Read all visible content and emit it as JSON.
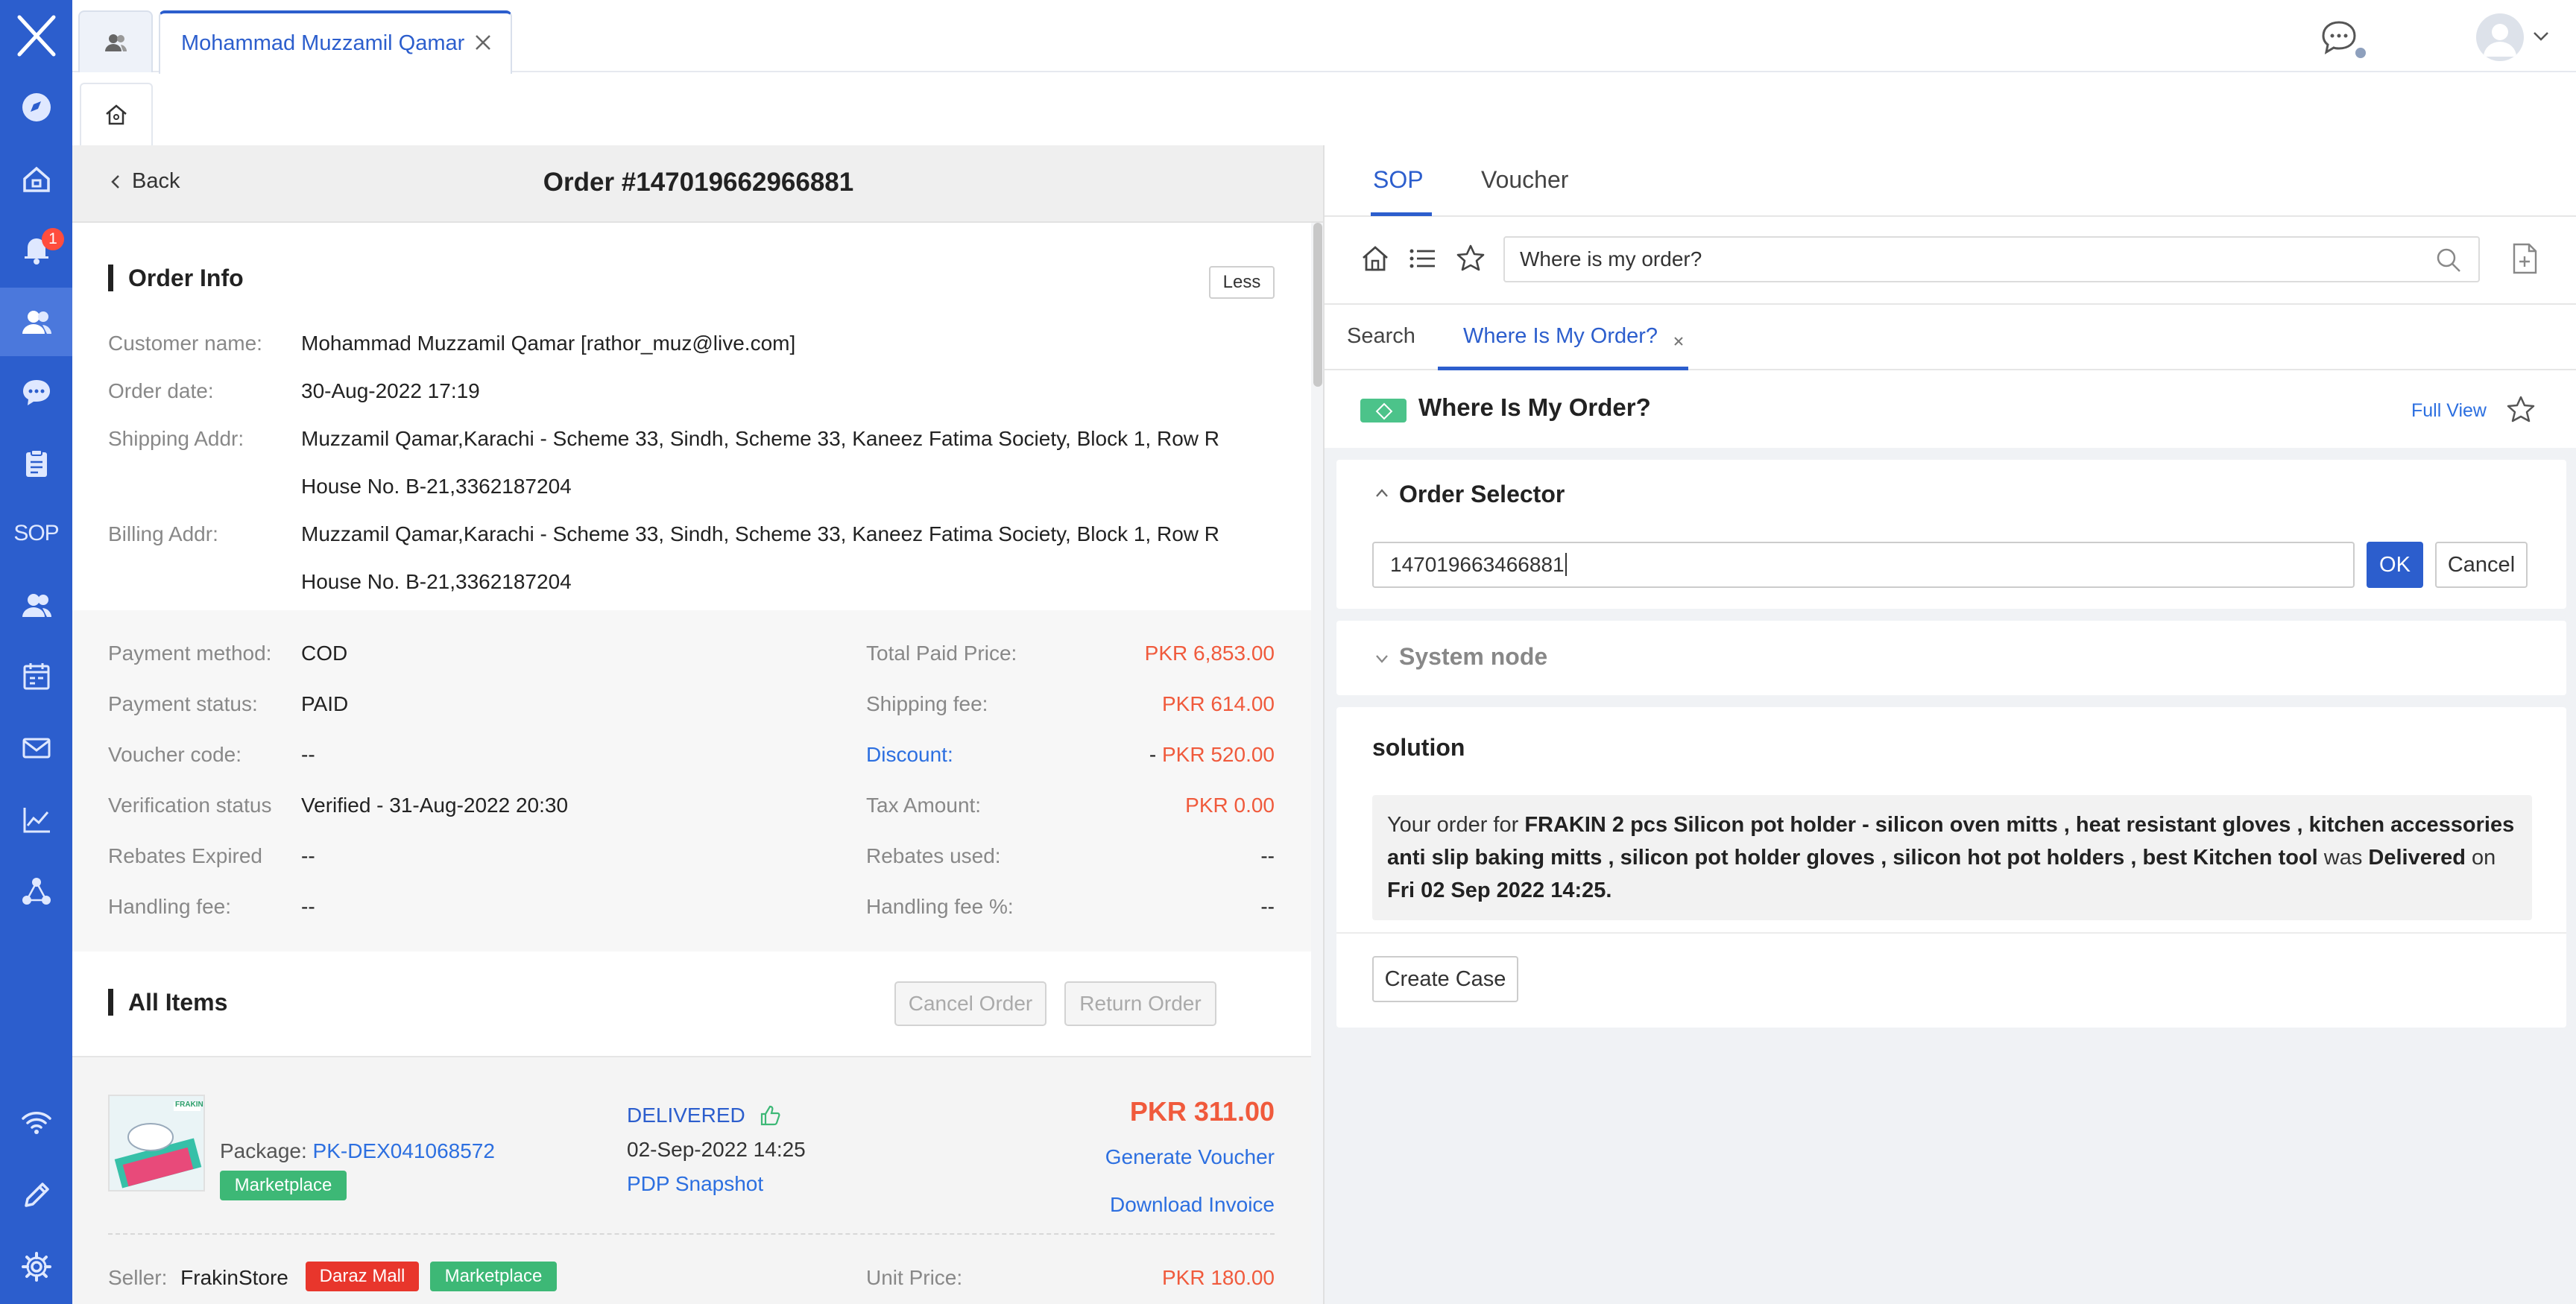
{
  "sidebar": {
    "notification_count": "1",
    "sop_label": "SOP",
    "items": [
      "compass-icon",
      "home-icon",
      "bell-icon",
      "contacts-icon",
      "chat-icon",
      "clipboard-icon",
      "sop-icon",
      "users-icon",
      "calendar-icon",
      "mail-icon",
      "chart-icon",
      "network-icon"
    ],
    "bottom": [
      "wifi-icon",
      "pencil-icon",
      "gear-icon"
    ]
  },
  "topbar": {
    "customer_tab_label": "Mohammad Muzzamil Qamar"
  },
  "order": {
    "back_label": "Back",
    "title": "Order #147019662966881",
    "info_title": "Order Info",
    "less_label": "Less",
    "customer_name_label": "Customer name:",
    "customer_name_value": "Mohammad Muzzamil Qamar [rathor_muz@live.com]",
    "order_date_label": "Order date:",
    "order_date_value": "30-Aug-2022 17:19",
    "shipping_label": "Shipping Addr:",
    "shipping_line1": "Muzzamil Qamar,Karachi - Scheme 33, Sindh, Scheme 33, Kaneez Fatima Society, Block 1, Row R",
    "shipping_line2": "House No. B-21,3362187204",
    "billing_label": "Billing Addr:",
    "billing_line1": "Muzzamil Qamar,Karachi - Scheme 33, Sindh, Scheme 33, Kaneez Fatima Society, Block 1, Row R",
    "billing_line2": "House No. B-21,3362187204"
  },
  "payment": {
    "method_label": "Payment method:",
    "method_value": "COD",
    "status_label": "Payment status:",
    "status_value": "PAID",
    "voucher_label": "Voucher code:",
    "voucher_value": "--",
    "verification_label": "Verification status",
    "verification_value": "Verified - 31-Aug-2022 20:30",
    "rebates_expired_label": "Rebates Expired",
    "rebates_expired_value": "--",
    "handling_fee_label": "Handling fee:",
    "handling_fee_value": "--",
    "total_paid_label": "Total Paid Price:",
    "total_paid_value": "PKR 6,853.00",
    "shipping_fee_label": "Shipping fee:",
    "shipping_fee_value": "PKR 614.00",
    "discount_label": "Discount:",
    "discount_prefix": "- ",
    "discount_value": "PKR 520.00",
    "tax_label": "Tax Amount:",
    "tax_value": "PKR 0.00",
    "rebates_used_label": "Rebates used:",
    "rebates_used_value": "--",
    "handling_pct_label": "Handling fee %:",
    "handling_pct_value": "--"
  },
  "items": {
    "title": "All Items",
    "cancel_order": "Cancel Order",
    "return_order": "Return Order",
    "package_label": "Package:",
    "package_id": "PK-DEX041068572",
    "marketplace_tag": "Marketplace",
    "status": "DELIVERED",
    "status_date": "02-Sep-2022 14:25",
    "pdp_snapshot": "PDP Snapshot",
    "price": "PKR 311.00",
    "generate_voucher": "Generate Voucher",
    "download_invoice": "Download Invoice",
    "seller_label": "Seller:",
    "seller_name": "FrakinStore",
    "daraz_mall_tag": "Daraz Mall",
    "marketplace_tag2": "Marketplace",
    "unit_price_label": "Unit Price:",
    "unit_price_value": "PKR 180.00",
    "thumb_brand": "FRAKIN"
  },
  "right": {
    "tabs": [
      "SOP",
      "Voucher"
    ],
    "search_value": "Where is my order?",
    "subtabs": [
      "Search",
      "Where Is My Order?"
    ],
    "header_title": "Where Is My Order?",
    "full_view": "Full View",
    "order_selector_title": "Order Selector",
    "order_input_value": "147019663466881",
    "ok_label": "OK",
    "cancel_label": "Cancel",
    "system_node_title": "System node",
    "solution_title": "solution",
    "solution_p1": "Your order for ",
    "solution_product": "FRAKIN 2 pcs Silicon pot holder - silicon oven mitts , heat resistant gloves , kitchen accessories anti slip baking mitts , silicon pot holder gloves , silicon hot pot holders , best Kitchen tool",
    "solution_p2": " was ",
    "solution_status": "Delivered",
    "solution_p3": " on ",
    "solution_date": "Fri 02 Sep 2022 14:25.",
    "create_case": "Create Case"
  },
  "colors": {
    "sidebar_blue": "#2c5ecd",
    "price_red": "#f05a3c",
    "link_blue": "#2c6fe0",
    "tag_green": "#3db876",
    "tag_red": "#e8362c"
  }
}
